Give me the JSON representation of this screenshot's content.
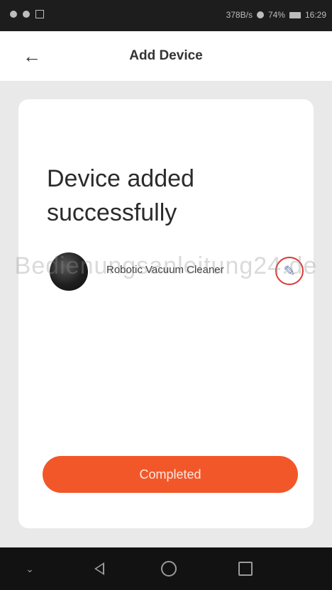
{
  "status_bar": {
    "network_speed": "378B/s",
    "battery": "74%",
    "time": "16:29"
  },
  "header": {
    "back_icon": "arrow-left-icon",
    "title": "Add Device"
  },
  "card": {
    "headline": "Device added successfully",
    "device": {
      "icon": "robot-vacuum-icon",
      "name": "Robotic Vacuum Cleaner",
      "edit_icon": "pencil-icon"
    },
    "button_label": "Completed"
  },
  "watermark": "Bedienungsanleitung24.de",
  "colors": {
    "accent": "#f2572a",
    "highlight_circle": "#d83a35"
  },
  "nav_bar": {
    "icons": [
      "chevron-down-icon",
      "back-triangle-icon",
      "home-circle-icon",
      "recent-square-icon"
    ]
  }
}
